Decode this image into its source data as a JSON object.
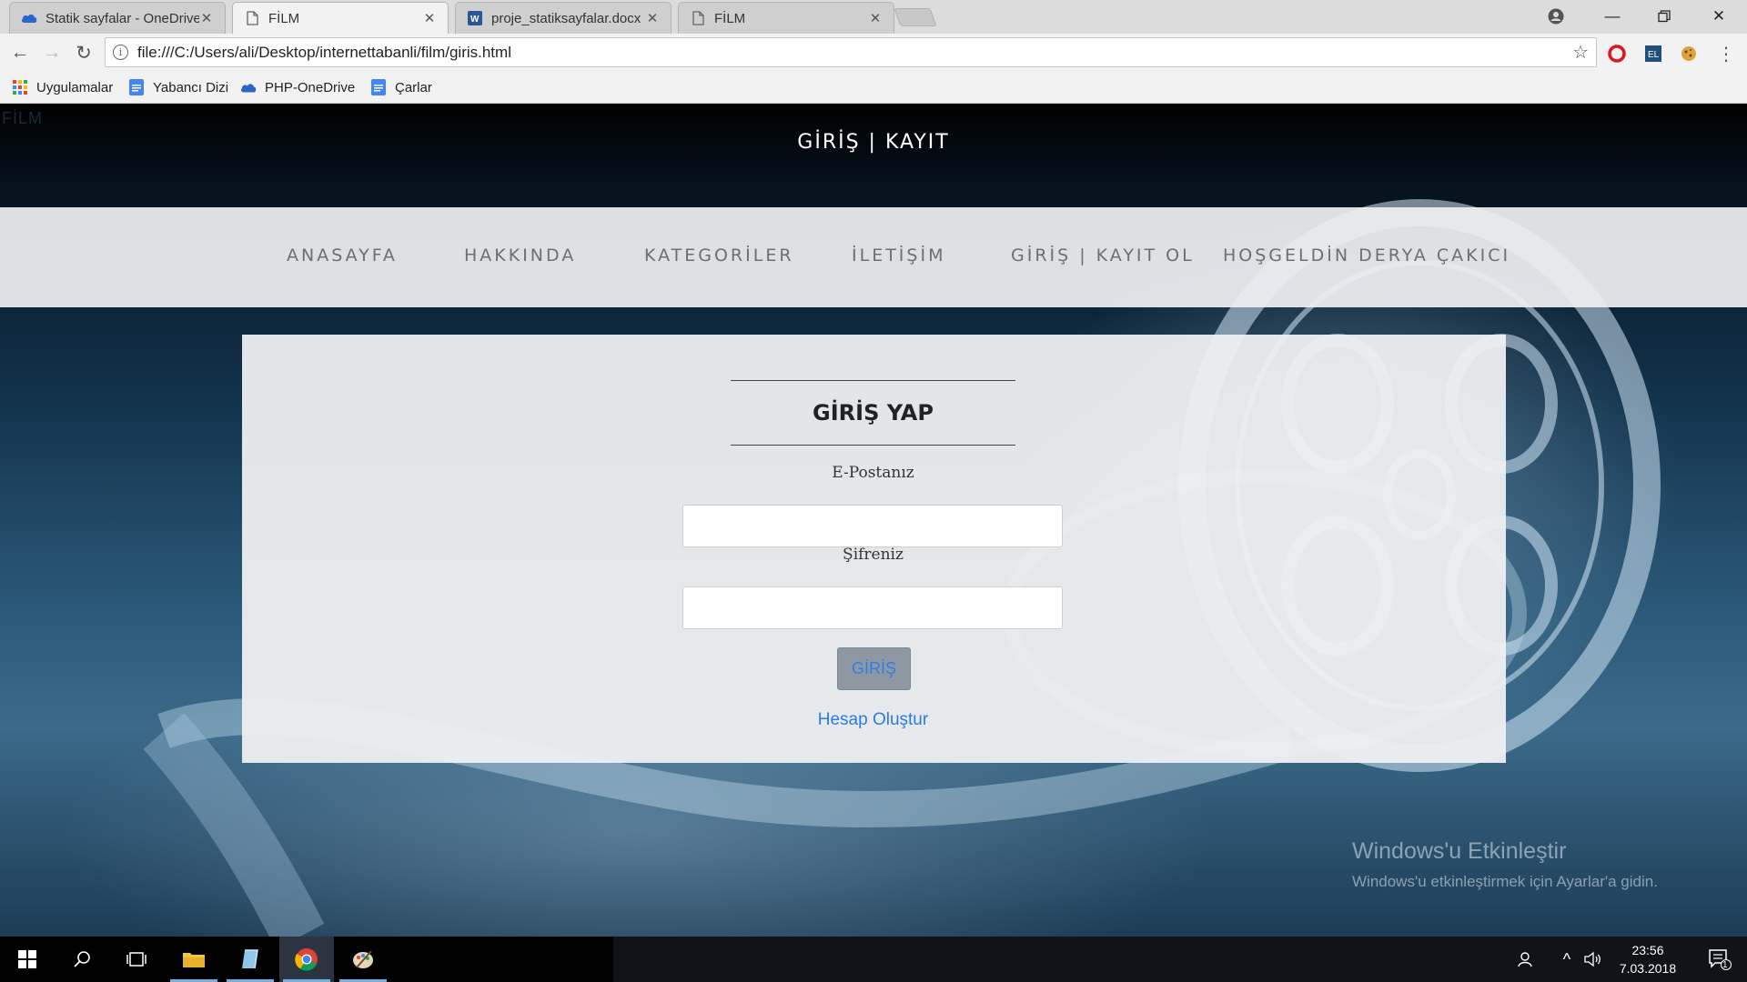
{
  "browser": {
    "tabs": [
      {
        "title": "Statik sayfalar - OneDrive",
        "icon": "onedrive-cloud-icon",
        "active": false
      },
      {
        "title": "FİLM",
        "icon": "page-icon",
        "active": true
      },
      {
        "title": "proje_statiksayfalar.docx",
        "icon": "word-doc-icon",
        "active": false
      },
      {
        "title": "FİLM",
        "icon": "page-icon",
        "active": false
      }
    ],
    "url": "file:///C:/Users/ali/Desktop/internettabanli/film/giris.html",
    "bookmarks": [
      {
        "label": "Uygulamalar",
        "icon": "apps-grid-icon"
      },
      {
        "label": "Yabancı Dizi",
        "icon": "docs-icon"
      },
      {
        "label": "PHP-OneDrive",
        "icon": "onedrive-cloud-icon"
      },
      {
        "label": "Çarlar",
        "icon": "docs-icon"
      }
    ]
  },
  "page": {
    "corner_text": "FİLM",
    "site_title": "GİRİŞ | KAYIT",
    "nav": [
      "ANASAYFA",
      "HAKKINDA",
      "KATEGORİLER",
      "İLETİŞİM",
      "GİRİŞ | KAYIT OL",
      "HOŞGELDİN DERYA ÇAKICI"
    ],
    "login": {
      "title": "GİRİŞ YAP",
      "email_label": "E-Postanız",
      "email_value": "",
      "password_label": "Şifreniz",
      "password_value": "",
      "submit_label": "GİRİŞ",
      "create_account_label": "Hesap Oluştur"
    },
    "watermark": {
      "title": "Windows'u Etkinleştir",
      "subtitle": "Windows'u etkinleştirmek için Ayarlar'a gidin."
    }
  },
  "taskbar": {
    "time": "23:56",
    "date": "7.03.2018",
    "notification_count": "1"
  },
  "colors": {
    "link": "#2a7be3",
    "submit_bg": "#8d98a2",
    "navbar_bg": "#eef0f2"
  }
}
